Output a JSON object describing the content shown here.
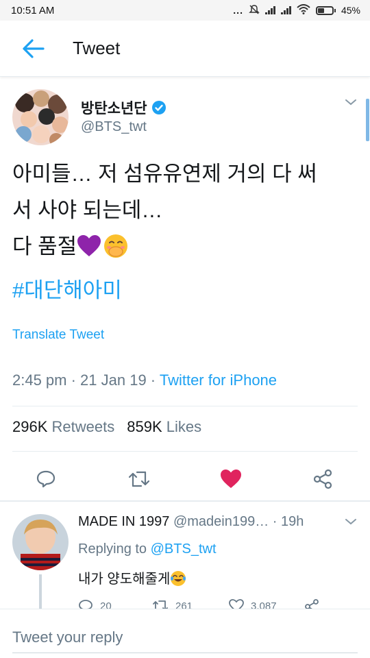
{
  "status_bar": {
    "time": "10:51 AM",
    "dots": "...",
    "battery_text": "45%",
    "battery_level": 0.45,
    "icons": [
      "silent-icon",
      "signal-icon",
      "signal-icon",
      "wifi-icon",
      "battery-icon"
    ]
  },
  "app_bar": {
    "back_icon": "arrow-left-icon",
    "title": "Tweet"
  },
  "tweet": {
    "author_name": "방탄소년단",
    "verified_icon": "verified-badge-icon",
    "author_handle": "@BTS_twt",
    "text_line1": "아미들… 저 섬유유연제 거의 다 써",
    "text_line2": "서 사야 되는데…",
    "text_line3": "다 품절",
    "emoji1": "💜",
    "emoji2": "🤭",
    "hashtag": "#대단해아미",
    "translate_label": "Translate Tweet",
    "timestamp": "2:45 pm · 21 Jan 19 · ",
    "source": "Twitter for iPhone",
    "retweets_count": "296K",
    "retweets_label": "Retweets",
    "likes_count": "859K",
    "likes_label": "Likes",
    "liked": true,
    "colors": {
      "accent": "#1da1f2",
      "like": "#e0245e",
      "muted": "#657786"
    }
  },
  "reply": {
    "name": "MADE IN 1997",
    "handle": "@madein199…",
    "time": "· 19h",
    "replying_prefix": "Replying to ",
    "replying_to": "@BTS_twt",
    "text": "내가 양도해줄게",
    "emoji": "😂",
    "reply_count": "20",
    "retweet_count": "261",
    "like_count": "3,087"
  },
  "composer": {
    "placeholder": "Tweet your reply"
  }
}
